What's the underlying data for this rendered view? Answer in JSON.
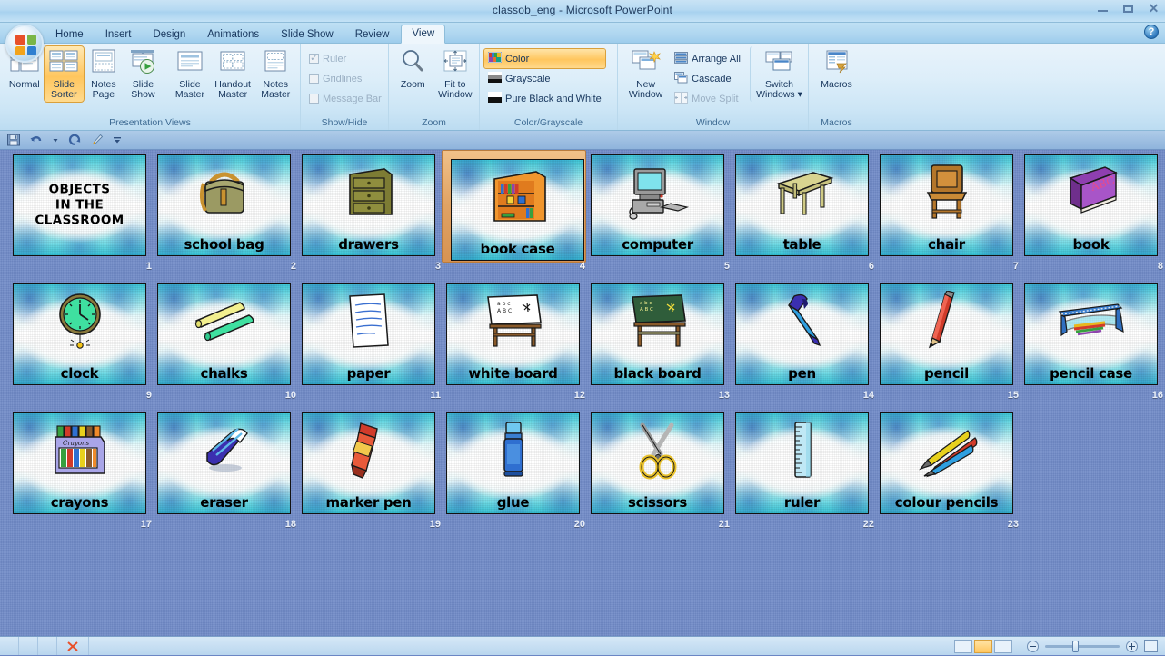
{
  "window": {
    "title": "classob_eng  -  Microsoft PowerPoint",
    "minimize_label": "Minimize",
    "restore_label": "Restore Down",
    "close_label": "Close",
    "help_label": "?"
  },
  "office_button": {
    "name": "Office Button"
  },
  "tabs": [
    {
      "label": "Home",
      "active": false
    },
    {
      "label": "Insert",
      "active": false
    },
    {
      "label": "Design",
      "active": false
    },
    {
      "label": "Animations",
      "active": false
    },
    {
      "label": "Slide Show",
      "active": false
    },
    {
      "label": "Review",
      "active": false
    },
    {
      "label": "View",
      "active": true
    }
  ],
  "ribbon": {
    "groups": [
      {
        "title": "Presentation Views",
        "buttons": [
          {
            "label_1": "Normal",
            "label_2": "",
            "selected": false,
            "icon": "normal-view-icon"
          },
          {
            "label_1": "Slide",
            "label_2": "Sorter",
            "selected": true,
            "icon": "slide-sorter-icon"
          },
          {
            "label_1": "Notes",
            "label_2": "Page",
            "selected": false,
            "icon": "notes-page-icon"
          },
          {
            "label_1": "Slide",
            "label_2": "Show",
            "selected": false,
            "icon": "slide-show-icon"
          },
          {
            "label_1": "Slide",
            "label_2": "Master",
            "selected": false,
            "icon": "slide-master-icon"
          },
          {
            "label_1": "Handout",
            "label_2": "Master",
            "selected": false,
            "icon": "handout-master-icon"
          },
          {
            "label_1": "Notes",
            "label_2": "Master",
            "selected": false,
            "icon": "notes-master-icon"
          }
        ]
      },
      {
        "title": "Show/Hide",
        "checks": [
          {
            "label": "Ruler",
            "checked": true,
            "disabled": true
          },
          {
            "label": "Gridlines",
            "checked": false,
            "disabled": true
          },
          {
            "label": "Message Bar",
            "checked": false,
            "disabled": true
          }
        ]
      },
      {
        "title": "Zoom",
        "buttons": [
          {
            "label_1": "Zoom",
            "label_2": "",
            "selected": false,
            "icon": "magnifier-icon"
          },
          {
            "label_1": "Fit to",
            "label_2": "Window",
            "selected": false,
            "icon": "fit-to-window-icon"
          }
        ]
      },
      {
        "title": "Color/Grayscale",
        "rows": [
          {
            "label": "Color",
            "on": true,
            "swatch": "color-swatch-icon"
          },
          {
            "label": "Grayscale",
            "on": false,
            "swatch": "grayscale-swatch-icon"
          },
          {
            "label": "Pure Black and White",
            "on": false,
            "swatch": "blackwhite-swatch-icon"
          }
        ]
      },
      {
        "title": "Window",
        "buttons": [
          {
            "label_1": "New",
            "label_2": "Window",
            "selected": false,
            "icon": "new-window-icon"
          }
        ],
        "rows": [
          {
            "label": "Arrange All",
            "disabled": false,
            "icon": "arrange-all-icon"
          },
          {
            "label": "Cascade",
            "disabled": false,
            "icon": "cascade-icon"
          },
          {
            "label": "Move Split",
            "disabled": true,
            "icon": "move-split-icon"
          }
        ],
        "buttons2": [
          {
            "label_1": "Switch",
            "label_2": "Windows ▾",
            "selected": false,
            "icon": "switch-windows-icon"
          }
        ]
      },
      {
        "title": "Macros",
        "buttons": [
          {
            "label_1": "Macros",
            "label_2": "",
            "selected": false,
            "icon": "macros-icon"
          }
        ]
      }
    ]
  },
  "quick_toolbar": [
    {
      "name": "save-icon",
      "label": "Save"
    },
    {
      "name": "undo-icon",
      "label": "Undo"
    },
    {
      "name": "undo-dropdown-icon",
      "label": "Undo options"
    },
    {
      "name": "redo-icon",
      "label": "Redo"
    },
    {
      "name": "format-painter-icon",
      "label": "Format Painter"
    },
    {
      "name": "customize-qat-icon",
      "label": "Customize Quick Access Toolbar"
    }
  ],
  "slides": [
    {
      "n": "1",
      "caption": "OBJECTS\nIN THE\nCLASSROOM",
      "is_title": true,
      "art": "none",
      "selected": false
    },
    {
      "n": "2",
      "caption": "school bag",
      "is_title": false,
      "art": "backpack",
      "selected": false
    },
    {
      "n": "3",
      "caption": "drawers",
      "is_title": false,
      "art": "drawers",
      "selected": false
    },
    {
      "n": "4",
      "caption": "book case",
      "is_title": false,
      "art": "bookcase",
      "selected": true
    },
    {
      "n": "5",
      "caption": "computer",
      "is_title": false,
      "art": "computer",
      "selected": false
    },
    {
      "n": "6",
      "caption": "table",
      "is_title": false,
      "art": "table",
      "selected": false
    },
    {
      "n": "7",
      "caption": "chair",
      "is_title": false,
      "art": "chair",
      "selected": false
    },
    {
      "n": "8",
      "caption": "book",
      "is_title": false,
      "art": "book",
      "selected": false
    },
    {
      "n": "9",
      "caption": "clock",
      "is_title": false,
      "art": "clock",
      "selected": false
    },
    {
      "n": "10",
      "caption": "chalks",
      "is_title": false,
      "art": "chalks",
      "selected": false
    },
    {
      "n": "11",
      "caption": "paper",
      "is_title": false,
      "art": "paper",
      "selected": false
    },
    {
      "n": "12",
      "caption": "white board",
      "is_title": false,
      "art": "whiteboard",
      "selected": false
    },
    {
      "n": "13",
      "caption": "black board",
      "is_title": false,
      "art": "blackboard",
      "selected": false
    },
    {
      "n": "14",
      "caption": "pen",
      "is_title": false,
      "art": "pen",
      "selected": false
    },
    {
      "n": "15",
      "caption": "pencil",
      "is_title": false,
      "art": "pencil",
      "selected": false
    },
    {
      "n": "16",
      "caption": "pencil case",
      "is_title": false,
      "art": "pencilcase",
      "selected": false
    },
    {
      "n": "17",
      "caption": "crayons",
      "is_title": false,
      "art": "crayons",
      "selected": false
    },
    {
      "n": "18",
      "caption": "eraser",
      "is_title": false,
      "art": "eraser",
      "selected": false
    },
    {
      "n": "19",
      "caption": "marker pen",
      "is_title": false,
      "art": "marker",
      "selected": false
    },
    {
      "n": "20",
      "caption": "glue",
      "is_title": false,
      "art": "glue",
      "selected": false
    },
    {
      "n": "21",
      "caption": "scissors",
      "is_title": false,
      "art": "scissors",
      "selected": false
    },
    {
      "n": "22",
      "caption": "ruler",
      "is_title": false,
      "art": "ruler",
      "selected": false
    },
    {
      "n": "23",
      "caption": "colour pencils",
      "is_title": false,
      "art": "colourpencils",
      "selected": false
    }
  ],
  "colors": {
    "accent_orange": "#ffc65e",
    "selection_border": "#d79352",
    "workspace_blue": "#6f89c6",
    "ribbon_blue": "#cde6f6",
    "title_text": "#1e395b"
  }
}
